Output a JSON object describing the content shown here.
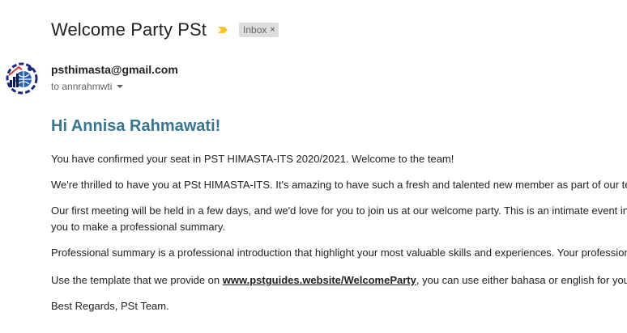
{
  "email": {
    "subject": "Welcome Party PSt",
    "label": "Inbox",
    "label_close": "×",
    "sender": "psthimasta@gmail.com",
    "to_line": "to annrahmwti",
    "greeting": "Hi Annisa Rahmawati!",
    "body": {
      "p1": "You have confirmed your seat in PST HIMASTA-ITS 2020/2021. Welcome to the team!",
      "p2": "We're thrilled to have you at PSt HIMASTA-ITS. It's amazing to have such a fresh and talented new member as part of our te",
      "p3_line1": "Our first meeting will be held in a few days, and we'd love for you to join us at our welcome party. This is an intimate event int",
      "p3_line2": "you to make a professional summary.",
      "p4": "Professional summary is a professional introduction that highlight your most valuable skills and experiences. Your profession",
      "p5_before": "Use the template that we provide on ",
      "p5_link": "www.pstguides.website/WelcomeParty",
      "p5_after": ", you can use either bahasa or english for you",
      "p6": "Best Regards, PSt Team."
    }
  },
  "icons": {
    "importance": "importance-marker-icon",
    "avatar": "sender-logo-avatar",
    "caret": "chevron-down-icon"
  },
  "colors": {
    "greeting": "#38758f",
    "importance": "#f4c430",
    "label_bg": "#dddddd"
  }
}
